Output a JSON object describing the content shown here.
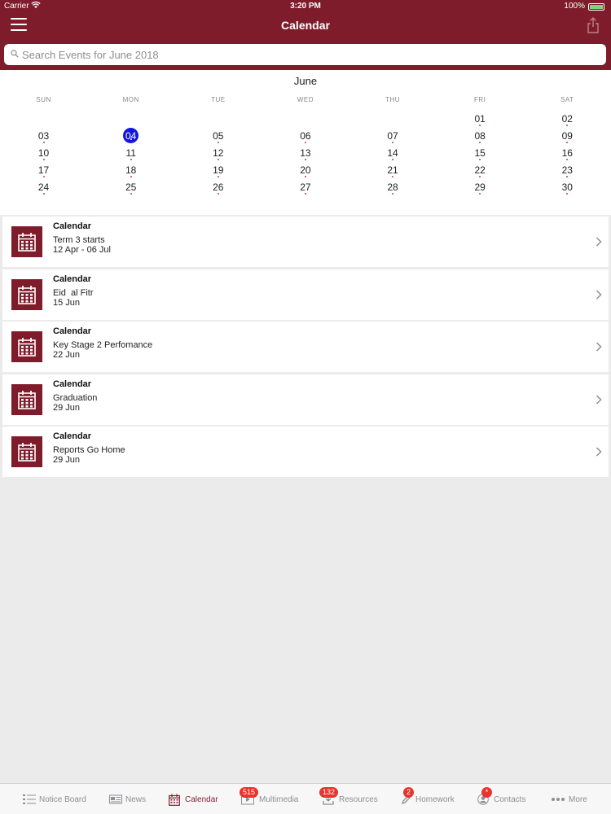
{
  "status_bar": {
    "carrier": "Carrier",
    "time": "3:20 PM",
    "battery": "100%"
  },
  "nav": {
    "title": "Calendar"
  },
  "search": {
    "placeholder": "Search Events for June 2018"
  },
  "calendar": {
    "month": "June",
    "weekdays": [
      "SUN",
      "MON",
      "TUE",
      "WED",
      "THU",
      "FRI",
      "SAT"
    ],
    "selected_day": "04",
    "weeks": [
      [
        "",
        "",
        "",
        "",
        "",
        "01",
        "02"
      ],
      [
        "03",
        "04",
        "05",
        "06",
        "07",
        "08",
        "09"
      ],
      [
        "10",
        "11",
        "12",
        "13",
        "14",
        "15",
        "16"
      ],
      [
        "17",
        "18",
        "19",
        "20",
        "21",
        "22",
        "23"
      ],
      [
        "24",
        "25",
        "26",
        "27",
        "28",
        "29",
        "30"
      ]
    ]
  },
  "events": [
    {
      "category": "Calendar",
      "title": "Term 3 starts",
      "date": "12 Apr - 06 Jul"
    },
    {
      "category": "Calendar",
      "title": "Eid  al Fitr",
      "date": "15 Jun"
    },
    {
      "category": "Calendar",
      "title": "Key Stage 2 Perfomance",
      "date": "22 Jun"
    },
    {
      "category": "Calendar",
      "title": "Graduation",
      "date": "29 Jun"
    },
    {
      "category": "Calendar",
      "title": "Reports Go Home",
      "date": "29 Jun"
    }
  ],
  "tabs": [
    {
      "label": "Notice Board",
      "icon": "list-icon",
      "badge": ""
    },
    {
      "label": "News",
      "icon": "newspaper-icon",
      "badge": ""
    },
    {
      "label": "Calendar",
      "icon": "calendar-icon",
      "badge": ""
    },
    {
      "label": "Multimedia",
      "icon": "multimedia-icon",
      "badge": "515"
    },
    {
      "label": "Resources",
      "icon": "download-icon",
      "badge": "132"
    },
    {
      "label": "Homework",
      "icon": "pencil-icon",
      "badge": "2"
    },
    {
      "label": "Contacts",
      "icon": "contacts-icon",
      "badge": "*"
    },
    {
      "label": "More",
      "icon": "more-icon",
      "badge": ""
    }
  ],
  "colors": {
    "brand": "#7f1c2b",
    "selected_day": "#1414e0",
    "badge": "#e8332e"
  }
}
